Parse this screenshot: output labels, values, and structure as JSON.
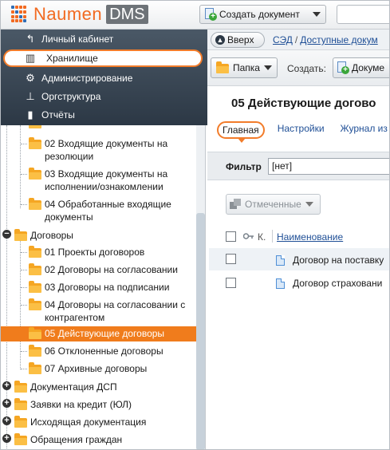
{
  "app": {
    "brand": "Naumen",
    "badge": "DMS"
  },
  "topbar": {
    "create_label": "Создать документ",
    "search_placeholder": ""
  },
  "nav": {
    "items": [
      {
        "label": "Личный кабинет",
        "icon": "back-arrow-icon"
      },
      {
        "label": "Хранилище",
        "icon": "storage-icon",
        "active": true
      },
      {
        "label": "Администрирование",
        "icon": "admin-icon"
      },
      {
        "label": "Оргструктура",
        "icon": "org-structure-icon"
      },
      {
        "label": "Отчёты",
        "icon": "reports-chart-icon"
      }
    ]
  },
  "tree": {
    "items": [
      {
        "label": "02 Входящие документы на резолюции"
      },
      {
        "label": "03 Входящие документы на исполнении/ознакомлении"
      },
      {
        "label": "04 Обработанные входящие документы"
      },
      {
        "label": "Договоры"
      },
      {
        "label": "01 Проекты договоров"
      },
      {
        "label": "02 Договоры на согласовании"
      },
      {
        "label": "03 Договоры на подписании"
      },
      {
        "label": "04 Договоры на согласовании с контрагентом"
      },
      {
        "label": "05 Действующие договоры",
        "selected": true
      },
      {
        "label": "06 Отклоненные договоры"
      },
      {
        "label": "07 Архивные договоры"
      },
      {
        "label": "Документация ДСП"
      },
      {
        "label": "Заявки на кредит (ЮЛ)"
      },
      {
        "label": "Исходящая документация"
      },
      {
        "label": "Обращения граждан"
      }
    ]
  },
  "breadcrumb": {
    "back_label": "Вверх",
    "crumb1": "СЭД",
    "separator": "/",
    "crumb2": "Доступные докум"
  },
  "actions": {
    "folder_label": "Папка",
    "create_label": "Создать:",
    "doc_label": "Докуме"
  },
  "page": {
    "title": "05 Действующие догово"
  },
  "tabs": [
    {
      "label": "Главная",
      "active": true
    },
    {
      "label": "Настройки"
    },
    {
      "label": "Журнал из"
    }
  ],
  "filter": {
    "label": "Фильтр",
    "value": "[нет]"
  },
  "marked_button": {
    "label": "Отмеченные"
  },
  "table": {
    "columns": [
      "К.",
      "Наименование"
    ],
    "rows": [
      {
        "name": "Договор на поставку"
      },
      {
        "name": "Договор страховани"
      }
    ]
  },
  "colors": {
    "accent": "#f27c2a",
    "nav_bg": "#2c3845",
    "link": "#1f4f96",
    "folder": "#f5a623"
  }
}
